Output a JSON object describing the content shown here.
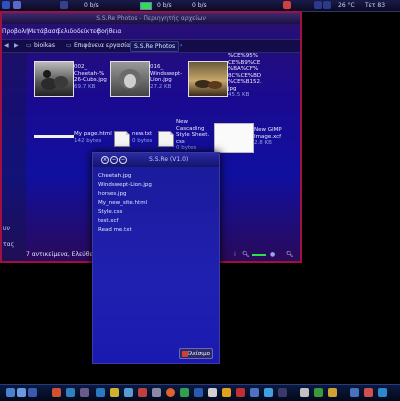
{
  "top_panel": {
    "net_down": "0 b/s",
    "net_up": "0 b/s",
    "meter1_fraction": 0.6,
    "temperature": "26 °C",
    "clock": "Τετ 83"
  },
  "file_manager": {
    "title": "S.S.Re Photos - Περιηγητής αρχείων",
    "menu": [
      "Προβολή",
      "Μετάβαση",
      "Σελιδοδείκτες",
      "Βοήθεια"
    ],
    "breadcrumbs": [
      "bioikas",
      "Επιφάνεια εργασίας",
      "S.S.Re Photos"
    ],
    "sidebar_items": [
      "υν",
      "τας"
    ],
    "files": [
      {
        "name": "002_\nCheetah-%\n26-Cubs.jpg",
        "size": "69.7 KB",
        "kind": "image-cheetah"
      },
      {
        "name": "016_\nWindswept-\nLion.jpg",
        "size": "27.2 KB",
        "kind": "image-lion"
      },
      {
        "name": "%CE%95%\nCE%B9%CE\n%BA%CF%\n8C%CE%BD\n%CE%B152.\njpg",
        "size": "45.5 KB",
        "kind": "image-horses"
      },
      {
        "name": "My page.html",
        "size": "142 bytes",
        "kind": "html"
      },
      {
        "name": "new.txt",
        "size": "0 bytes",
        "kind": "txt"
      },
      {
        "name": "New\nCascading\nStyle Sheet.\ncss",
        "size": "0 bytes",
        "kind": "css"
      },
      {
        "name": "New GIMP\nImage.xcf",
        "size": "2.8 KB",
        "kind": "xcf"
      }
    ],
    "status": "7 αντικείμενα, Ελεύθερος χ"
  },
  "dialog": {
    "title": "S.S.Re (V1.0)",
    "items": [
      "Cheetah.jpg",
      "Windswept-Lion.jpg",
      "horses.jpg",
      "My_new_site.html",
      "Style.css",
      "test.xcf",
      "Read me.txt"
    ],
    "close_label": "Κλείσιμο"
  },
  "colors": {
    "accent": "#2de04a",
    "window_border": "#a01040",
    "dialog_bg": "#2020b0"
  }
}
